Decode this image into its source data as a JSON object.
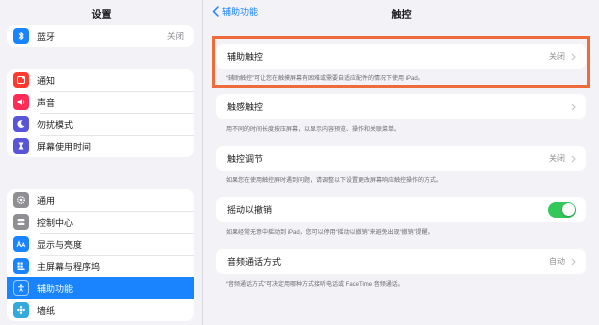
{
  "sidebar": {
    "title": "设置",
    "groups": [
      {
        "items": [
          {
            "label": "蓝牙",
            "value": "关闭",
            "icon": "bluetooth-icon",
            "color": "#1a84ff"
          }
        ]
      },
      {
        "items": [
          {
            "label": "通知",
            "icon": "notification-icon",
            "color": "#ff3b30"
          },
          {
            "label": "声音",
            "icon": "speaker-icon",
            "color": "#ff2d55"
          },
          {
            "label": "勿扰模式",
            "icon": "moon-icon",
            "color": "#5856d6"
          },
          {
            "label": "屏幕使用时间",
            "icon": "hourglass-icon",
            "color": "#5856d6"
          }
        ]
      },
      {
        "items": [
          {
            "label": "通用",
            "icon": "gear-icon",
            "color": "#8e8e93"
          },
          {
            "label": "控制中心",
            "icon": "switches-icon",
            "color": "#8e8e93"
          },
          {
            "label": "显示与亮度",
            "icon": "text-size-icon",
            "color": "#1a84ff"
          },
          {
            "label": "主屏幕与程序坞",
            "icon": "grid-icon",
            "color": "#1a84ff"
          },
          {
            "label": "辅助功能",
            "icon": "accessibility-icon",
            "color": "#1a84ff",
            "active": true
          },
          {
            "label": "墙纸",
            "icon": "flower-icon",
            "color": "#34aadc"
          }
        ]
      }
    ]
  },
  "detail": {
    "back_label": "辅助功能",
    "title": "触控",
    "rows": [
      {
        "label": "辅助触控",
        "value": "关闭",
        "note": "“辅助触控”可让您在触摸屏幕有困难或需要自适应配件的情况下使用 iPad。"
      },
      {
        "label": "触感触控",
        "value": "",
        "note": "用不同的时间长度按压屏幕，以显示内容预览、操作和关联菜单。"
      },
      {
        "label": "触控调节",
        "value": "关闭",
        "note": "如果您在使用触控屏时遇到问题，请调整以下设置更改屏幕响应触控操作的方式。"
      },
      {
        "label": "摇动以撤销",
        "toggle": true,
        "note": "如果经常无意中摇动到 iPad，您可以停用“摇动以撤销”来避免出现“撤销”提醒。"
      },
      {
        "label": "音频通话方式",
        "value": "自动",
        "note": "“音频通话方式”可决定用哪种方式接听电话或 FaceTime 音频通话。"
      }
    ],
    "highlight_color": "#ee6b3b",
    "toggle_on_color": "#34c759"
  }
}
